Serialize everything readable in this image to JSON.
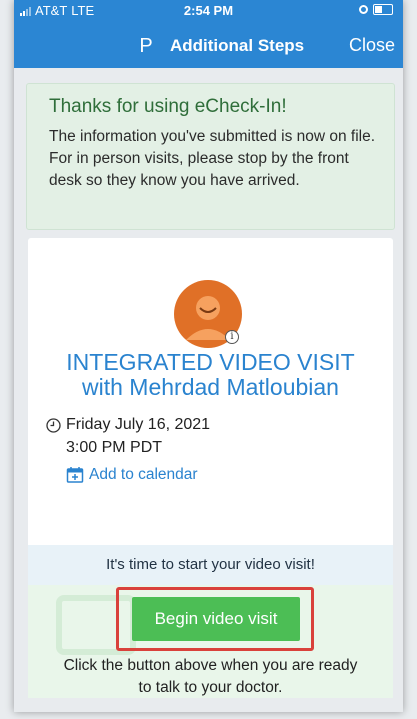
{
  "status_bar": {
    "carrier": "AT&T",
    "network": "LTE",
    "time": "2:54 PM"
  },
  "nav": {
    "logo": "P",
    "title": "Additional Steps",
    "close_label": "Close",
    "accent": "#2b86d3"
  },
  "thanks": {
    "title": "Thanks for using eCheck-In!",
    "message": "The information you've submitted is now on file. For in person visits, please stop by the front desk so they know you have arrived."
  },
  "visit": {
    "title_line1": "INTEGRATED VIDEO VISIT",
    "title_line2": "with Mehrdad Matloubian",
    "date": "Friday July 16, 2021",
    "time": "3:00 PM PDT",
    "add_to_calendar": "Add to calendar",
    "avatar_color": "#e07027"
  },
  "video": {
    "banner": "It's time to start your video visit!",
    "begin_label": "Begin video visit",
    "note_line1": "Click the button above when you are ready",
    "note_line2": "to talk to your doctor.",
    "button_color": "#4cbe55"
  },
  "icons": [
    "signal-icon",
    "lock-icon",
    "battery-icon",
    "app-logo-icon",
    "avatar-icon",
    "info-icon",
    "clock-icon",
    "calendar-icon"
  ]
}
